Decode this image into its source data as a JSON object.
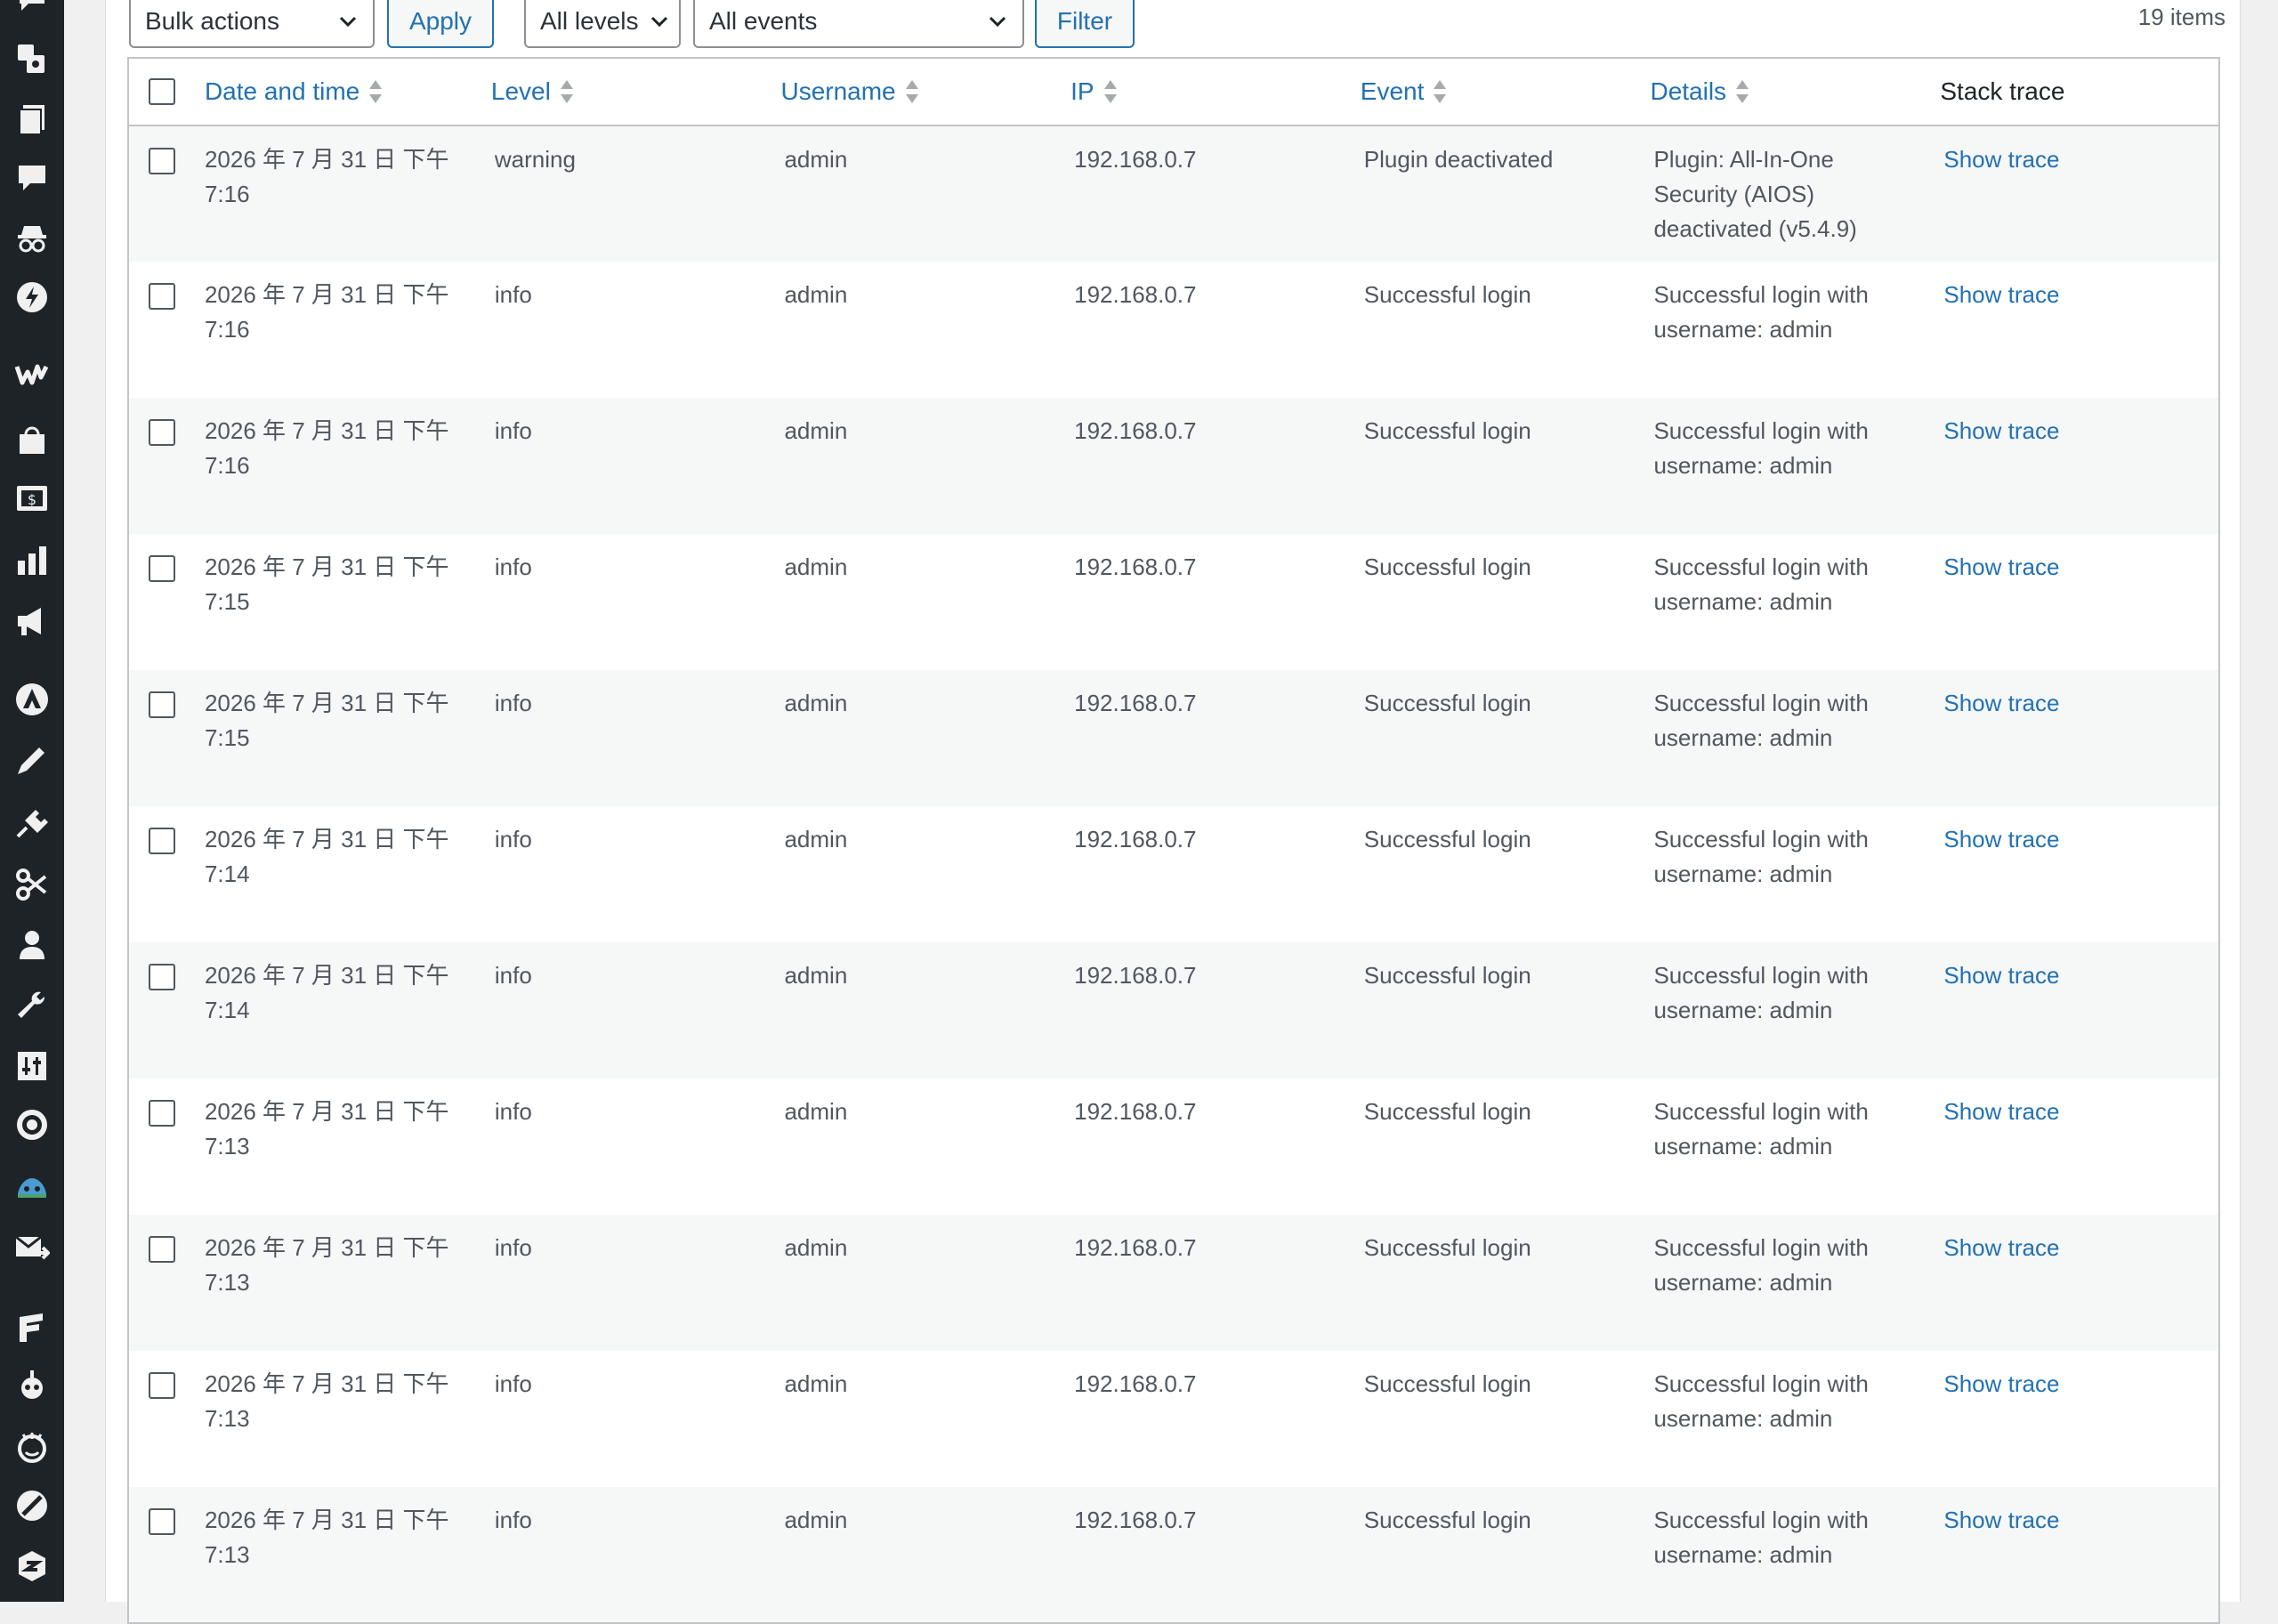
{
  "toolbar": {
    "bulk_actions": "Bulk actions",
    "apply": "Apply",
    "levels": "All levels",
    "events": "All events",
    "filter": "Filter",
    "items_count": "19 items"
  },
  "columns": {
    "date": "Date and time",
    "level": "Level",
    "username": "Username",
    "ip": "IP",
    "event": "Event",
    "details": "Details",
    "trace": "Stack trace"
  },
  "rows": [
    {
      "date": "2026 年 7 月 31 日 下午 7:16",
      "level": "warning",
      "username": "admin",
      "ip": "192.168.0.7",
      "event": "Plugin deactivated",
      "details": "Plugin: All-In-One Security (AIOS) deactivated (v5.4.9)",
      "trace": "Show trace"
    },
    {
      "date": "2026 年 7 月 31 日 下午 7:16",
      "level": "info",
      "username": "admin",
      "ip": "192.168.0.7",
      "event": "Successful login",
      "details": "Successful login with username: admin",
      "trace": "Show trace"
    },
    {
      "date": "2026 年 7 月 31 日 下午 7:16",
      "level": "info",
      "username": "admin",
      "ip": "192.168.0.7",
      "event": "Successful login",
      "details": "Successful login with username: admin",
      "trace": "Show trace"
    },
    {
      "date": "2026 年 7 月 31 日 下午 7:15",
      "level": "info",
      "username": "admin",
      "ip": "192.168.0.7",
      "event": "Successful login",
      "details": "Successful login with username: admin",
      "trace": "Show trace"
    },
    {
      "date": "2026 年 7 月 31 日 下午 7:15",
      "level": "info",
      "username": "admin",
      "ip": "192.168.0.7",
      "event": "Successful login",
      "details": "Successful login with username: admin",
      "trace": "Show trace"
    },
    {
      "date": "2026 年 7 月 31 日 下午 7:14",
      "level": "info",
      "username": "admin",
      "ip": "192.168.0.7",
      "event": "Successful login",
      "details": "Successful login with username: admin",
      "trace": "Show trace"
    },
    {
      "date": "2026 年 7 月 31 日 下午 7:14",
      "level": "info",
      "username": "admin",
      "ip": "192.168.0.7",
      "event": "Successful login",
      "details": "Successful login with username: admin",
      "trace": "Show trace"
    },
    {
      "date": "2026 年 7 月 31 日 下午 7:13",
      "level": "info",
      "username": "admin",
      "ip": "192.168.0.7",
      "event": "Successful login",
      "details": "Successful login with username: admin",
      "trace": "Show trace"
    },
    {
      "date": "2026 年 7 月 31 日 下午 7:13",
      "level": "info",
      "username": "admin",
      "ip": "192.168.0.7",
      "event": "Successful login",
      "details": "Successful login with username: admin",
      "trace": "Show trace"
    },
    {
      "date": "2026 年 7 月 31 日 下午 7:13",
      "level": "info",
      "username": "admin",
      "ip": "192.168.0.7",
      "event": "Successful login",
      "details": "Successful login with username: admin",
      "trace": "Show trace"
    },
    {
      "date": "2026 年 7 月 31 日 下午 7:13",
      "level": "info",
      "username": "admin",
      "ip": "192.168.0.7",
      "event": "Successful login",
      "details": "Successful login with username: admin",
      "trace": "Show trace"
    }
  ],
  "sidebar_icons": [
    "comments-partial-icon",
    "media-icon",
    "pages-icon",
    "comments-icon",
    "spy-icon",
    "lightning-icon",
    "woocommerce-icon",
    "store-icon",
    "payments-icon",
    "analytics-icon",
    "marketing-icon",
    "astra-icon",
    "appearance-icon",
    "plugins-icon",
    "snippets-icon",
    "users-icon",
    "tools-icon",
    "settings-icon",
    "cog-icon",
    "monster-icon",
    "mail-icon",
    "forms-icon",
    "bot-icon",
    "face-icon",
    "no-spam-icon",
    "security-icon"
  ]
}
